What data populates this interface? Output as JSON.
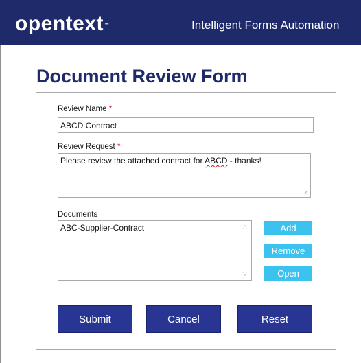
{
  "header": {
    "logo_text": "opentext",
    "logo_tm": "™",
    "app_name": "Intelligent Forms Automation"
  },
  "form": {
    "title": "Document Review Form",
    "review_name": {
      "label": "Review Name",
      "required_mark": "*",
      "value": "ABCD Contract"
    },
    "review_request": {
      "label": "Review Request",
      "required_mark": "*",
      "value_prefix": "Please review the attached contract for ",
      "value_flagged": "ABCD",
      "value_suffix": " - thanks!"
    },
    "documents": {
      "label": "Documents",
      "items": [
        "ABC-Supplier-Contract"
      ],
      "buttons": {
        "add": "Add",
        "remove": "Remove",
        "open": "Open"
      }
    },
    "actions": {
      "submit": "Submit",
      "cancel": "Cancel",
      "reset": "Reset"
    }
  },
  "colors": {
    "header_bg": "#1f2a6b",
    "title_color": "#1f2a6b",
    "primary_button": "#283593",
    "secondary_button": "#3cc2ef",
    "required_mark": "#d8141b"
  },
  "icons": {
    "scroll_up": "chevron-up-icon",
    "scroll_down": "chevron-down-icon",
    "resize": "resize-grip-icon"
  }
}
